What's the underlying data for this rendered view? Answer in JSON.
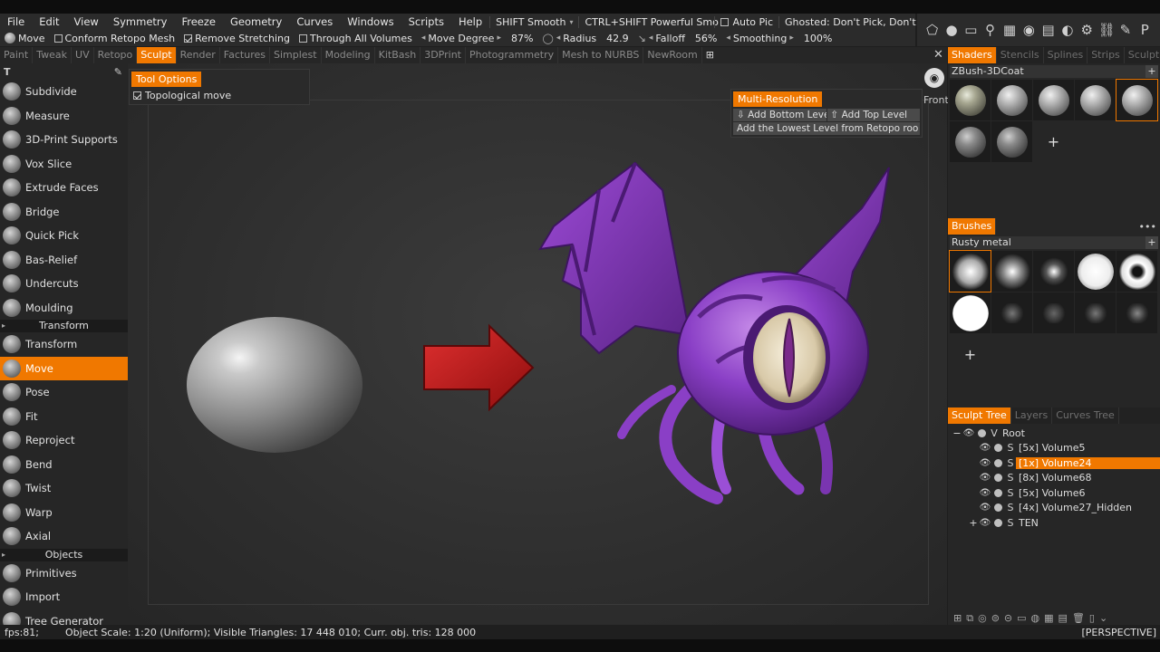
{
  "menu": [
    "File",
    "Edit",
    "View",
    "Symmetry",
    "Freeze",
    "Geometry",
    "Curves",
    "Windows",
    "Scripts",
    "Help"
  ],
  "menu_combos": {
    "shift": "SHIFT  Smooth",
    "ctrlshift": "CTRL+SHIFT  Powerful  Smo",
    "autopic": "Auto  Pic",
    "ghosted": "Ghosted:  Don't  Pick,  Don't  Act"
  },
  "options": {
    "tool": "Move",
    "conform": "Conform  Retopo  Mesh",
    "remove_stretching": "Remove  Stretching",
    "through": "Through  All  Volumes",
    "move_degree_label": "Move  Degree",
    "move_degree_value": "87%",
    "radius_label": "Radius",
    "radius_value": "42.9",
    "falloff_label": "Falloff",
    "falloff_value": "56%",
    "smoothing_label": "Smoothing",
    "smoothing_value": "100%"
  },
  "rooms": [
    "Paint",
    "Tweak",
    "UV",
    "Retopo",
    "Sculpt",
    "Render",
    "Factures",
    "Simplest",
    "Modeling",
    "KitBash",
    "3DPrint",
    "Photogrammetry",
    "Mesh  to  NURBS",
    "NewRoom"
  ],
  "active_room": "Sculpt",
  "left_tools_top": [
    {
      "label": "Subdivide",
      "icon": "subdivide-icon"
    },
    {
      "label": "Measure",
      "icon": "measure-icon"
    },
    {
      "label": "3D-Print  Supports",
      "icon": "print-supports-icon"
    },
    {
      "label": "Vox  Slice",
      "icon": "vox-slice-icon"
    },
    {
      "label": "Extrude  Faces",
      "icon": "extrude-faces-icon"
    },
    {
      "label": "Bridge",
      "icon": "bridge-icon"
    },
    {
      "label": "Quick  Pick",
      "icon": "quick-pick-icon"
    },
    {
      "label": "Bas-Relief",
      "icon": "bas-relief-icon"
    },
    {
      "label": "Undercuts",
      "icon": "undercuts-icon"
    },
    {
      "label": "Moulding",
      "icon": "moulding-icon"
    }
  ],
  "section_transform": "Transform",
  "left_tools_transform": [
    {
      "label": "Transform",
      "icon": "transform-icon"
    },
    {
      "label": "Move",
      "icon": "move-icon"
    },
    {
      "label": "Pose",
      "icon": "pose-icon"
    },
    {
      "label": "Fit",
      "icon": "fit-icon"
    },
    {
      "label": "Reproject",
      "icon": "reproject-icon"
    },
    {
      "label": "Bend",
      "icon": "bend-icon"
    },
    {
      "label": "Twist",
      "icon": "twist-icon"
    },
    {
      "label": "Warp",
      "icon": "warp-icon"
    },
    {
      "label": "Axial",
      "icon": "axial-icon"
    }
  ],
  "section_objects": "Objects",
  "left_tools_objects": [
    {
      "label": "Primitives",
      "icon": "primitives-icon"
    },
    {
      "label": "Import",
      "icon": "import-icon"
    },
    {
      "label": "Tree  Generator",
      "icon": "tree-generator-icon"
    }
  ],
  "tool_options": {
    "title": "Tool  Options",
    "topological_move": "Topological  move"
  },
  "multires": {
    "title": "Multi-Resolution",
    "add_bottom": "Add  Bottom  Leve",
    "add_top": "Add  Top  Level",
    "add_lowest": "Add  the  Lowest  Level  from  Retopo  roo"
  },
  "view_label": "Front",
  "shaders": {
    "tabs": [
      "Shaders",
      "Stencils",
      "Splines",
      "Strips",
      "Sculpt"
    ],
    "active": "Shaders",
    "preset": "ZBush-3DCoat"
  },
  "brushes": {
    "tab": "Brushes",
    "preset": "Rusty  metal"
  },
  "sculpt_tree": {
    "tabs": [
      "Sculpt  Tree",
      "Layers",
      "Curves  Tree"
    ],
    "active": "Sculpt  Tree",
    "root": "Root",
    "items": [
      {
        "label": "[5x]  Volume5",
        "selected": false
      },
      {
        "label": "[1x]  Volume24",
        "selected": true
      },
      {
        "label": "[8x]  Volume68",
        "selected": false
      },
      {
        "label": "[5x]  Volume6",
        "selected": false
      },
      {
        "label": "[4x]  Volume27_Hidden",
        "selected": false
      }
    ],
    "ten": "TEN"
  },
  "status": {
    "fps": "fps:81;",
    "stats": "Object  Scale:  1:20  (Uniform);  Visible  Triangles:  17  448  010;  Curr.  obj.  tris:  128  000",
    "view": "[PERSPECTIVE]"
  },
  "colors": {
    "accent": "#f07800",
    "monster": "#8a3fc6",
    "arrow": "#c91a1a"
  }
}
